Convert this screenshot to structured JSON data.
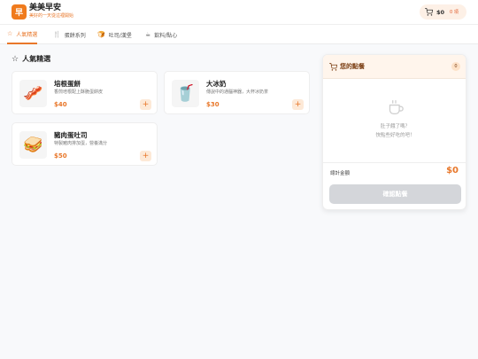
{
  "brand": {
    "logo_char": "早",
    "title": "美美早安",
    "subtitle": "美好的一天從這裡開始",
    "accent": "#e8772a"
  },
  "cart": {
    "icon": "cart-icon",
    "total": "$0",
    "count": "0 項"
  },
  "tabs": [
    {
      "icon": "☆",
      "label": "人氣精選",
      "active": true
    },
    {
      "icon": "🍴",
      "label": "蛋餅系列",
      "active": false
    },
    {
      "icon": "🍞",
      "label": "吐司/漢堡",
      "active": false
    },
    {
      "icon": "☕",
      "label": "飲料/點心",
      "active": false
    }
  ],
  "section": {
    "icon": "☆",
    "title": "人氣精選"
  },
  "products": [
    {
      "icon": "🥓",
      "name": "培根蛋餅",
      "desc": "香煎培根配上酥脆蛋餅皮",
      "price": "$40",
      "add": "+"
    },
    {
      "icon": "🥤",
      "name": "大冰奶",
      "desc": "傳說中的通腦神器，大杯冰奶茶",
      "price": "$30",
      "add": "+"
    },
    {
      "icon": "🥪",
      "name": "豬肉蛋吐司",
      "desc": "特製豬肉排加蛋，營養滿分",
      "price": "$50",
      "add": "+"
    }
  ],
  "order": {
    "title": "您的點餐",
    "badge": "0",
    "empty_icon": "coffee-cup-icon",
    "empty_line1": "肚子餓了嗎？",
    "empty_line2": "快點些好吃的吧！",
    "total_label": "總計金額",
    "total_value": "$0",
    "confirm_label": "確認點餐"
  }
}
